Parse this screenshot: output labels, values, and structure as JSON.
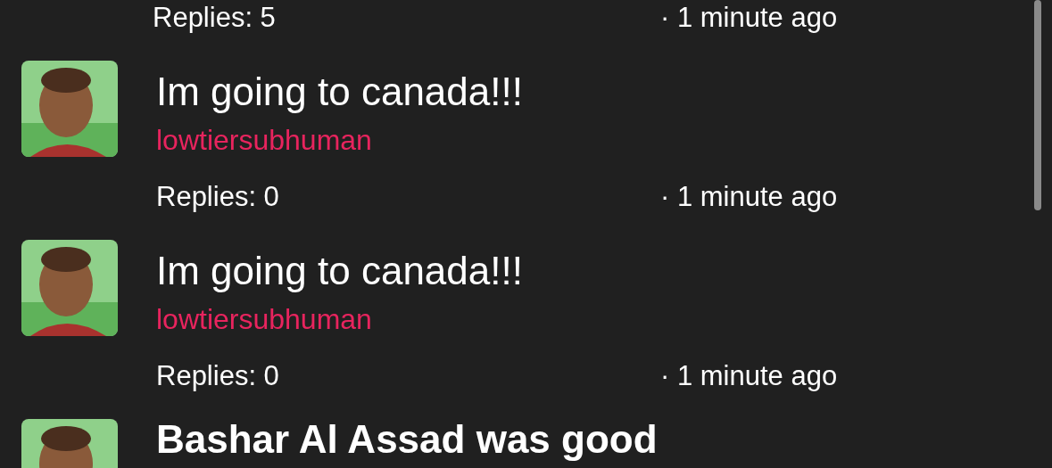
{
  "posts": [
    {
      "replies": "Replies: 5",
      "time": "· 1 minute ago"
    },
    {
      "title": "Im going to canada!!!",
      "unread": false,
      "author": "lowtiersubhuman",
      "replies": "Replies: 0",
      "time": "· 1 minute ago"
    },
    {
      "title": "Im going to canada!!!",
      "unread": false,
      "author": "lowtiersubhuman",
      "replies": "Replies: 0",
      "time": "· 1 minute ago"
    },
    {
      "title": "Bashar Al Assad was good",
      "unread": true
    }
  ]
}
